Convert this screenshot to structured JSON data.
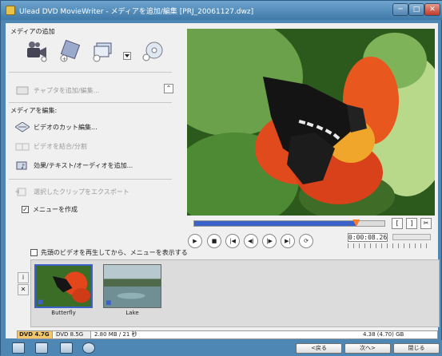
{
  "window": {
    "title": "Ulead DVD MovieWriter - メディアを追加/編集 [PRJ_20061127.dwz]",
    "min": "─",
    "max": "□",
    "close": "✕"
  },
  "left": {
    "add_media_label": "メディアの追加",
    "chapter_label": "チャプタを追加/編集...",
    "edit_media_label": "メディアを編集:",
    "cut_edit_label": "ビデオのカット編集...",
    "merge_split_label": "ビデオを結合/分割",
    "effects_label": "効果/テキスト/オーディオを追加...",
    "export_label": "選択したクリップをエクスポート",
    "create_menu_label": "メニューを作成",
    "collapse_glyph": "⌃"
  },
  "player": {
    "timecode": "0:00:08.26",
    "progress": 0.85,
    "trim_in": "[",
    "trim_out": "]",
    "scissors": "✂",
    "controls": [
      "▶",
      "■",
      "|◀",
      "◀|",
      "|▶",
      "▶|",
      "⟳"
    ]
  },
  "tray": {
    "play_first_label": "先頭のビデオを再生してから、メニューを表示する",
    "info_glyph": "i",
    "close_glyph": "✕",
    "clips": [
      {
        "label": "Butterfly"
      },
      {
        "label": "Lake"
      }
    ]
  },
  "capacity": {
    "dvd47": "DVD 4.7G",
    "dvd85": "DVD 8.5G",
    "used": "2.80 MB / 21 秒",
    "remaining": "4.38 (4.70) GB"
  },
  "nav": {
    "back": "<戻る",
    "next": "次へ>",
    "close": "閉じる"
  },
  "colors": {
    "accent": "#3a62c8",
    "seek_thumb": "#ff7a2a",
    "window": "#4e86b4"
  }
}
